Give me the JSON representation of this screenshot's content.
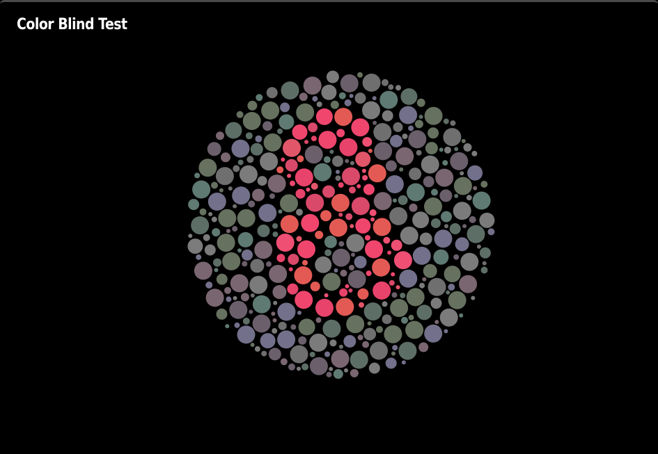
{
  "app": {
    "title": "Color Blind Test"
  },
  "plate": {
    "digit": "8",
    "colors": {
      "background": "#000000",
      "figure": [
        "#e8436a",
        "#ef4f73",
        "#e2566a",
        "#f0466e",
        "#e35a55",
        "#d9496a"
      ],
      "field": [
        "#6f6f6f",
        "#7a6670",
        "#5d6e66",
        "#72708a",
        "#66715f",
        "#7b7b7b",
        "#6a5f6a",
        "#5f7a72"
      ]
    }
  }
}
